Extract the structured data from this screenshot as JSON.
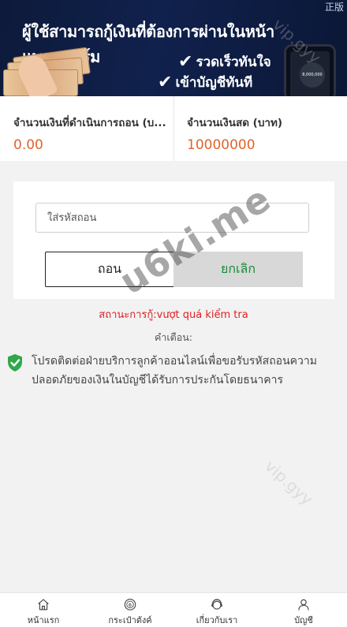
{
  "banner": {
    "title": "ผู้ใช้สามารถกู้เงินที่ต้องการผ่านในหน้าแพลตฟอร์ม",
    "corner_text": "正版",
    "checks": [
      "รวดเร็วทันใจ",
      "เข้าบัญชีทันที"
    ],
    "phone_balance": "8,000,000"
  },
  "summary": {
    "processing_label": "จำนวนเงินที่ดำเนินการถอน (บ...",
    "processing_value": "0.00",
    "cash_label": "จำนวนเงินสด (บาท)",
    "cash_value": "10000000"
  },
  "form": {
    "code_placeholder": "ใส่รหัสถอน",
    "withdraw_label": "ถอน",
    "cancel_label": "ยกเลิก"
  },
  "status_text": "สถานะการกู้:vượt quá kiểm tra",
  "notice": {
    "title": "คำเตือน:",
    "text": "โปรดติดต่อฝ่ายบริการลูกค้าออนไลน์เพื่อขอรับรหัสถอนความปลอดภัยของเงินในบัญชีได้รับการประกันโดยธนาคาร"
  },
  "watermark": "u6ki.me",
  "watermark_faint": "vip.gyy",
  "nav": {
    "items": [
      {
        "label": "หน้าแรก",
        "icon": "home-icon"
      },
      {
        "label": "กระเป๋าตังค์",
        "icon": "wallet-icon"
      },
      {
        "label": "เกี่ยวกับเรา",
        "icon": "support-icon"
      },
      {
        "label": "บัญชี",
        "icon": "user-icon"
      }
    ]
  },
  "colors": {
    "accent_orange": "#e0652a",
    "status_red": "#e02020",
    "cancel_green": "#1a8a3a",
    "shield_green": "#2ea84a",
    "banner_navy": "#10214d"
  }
}
